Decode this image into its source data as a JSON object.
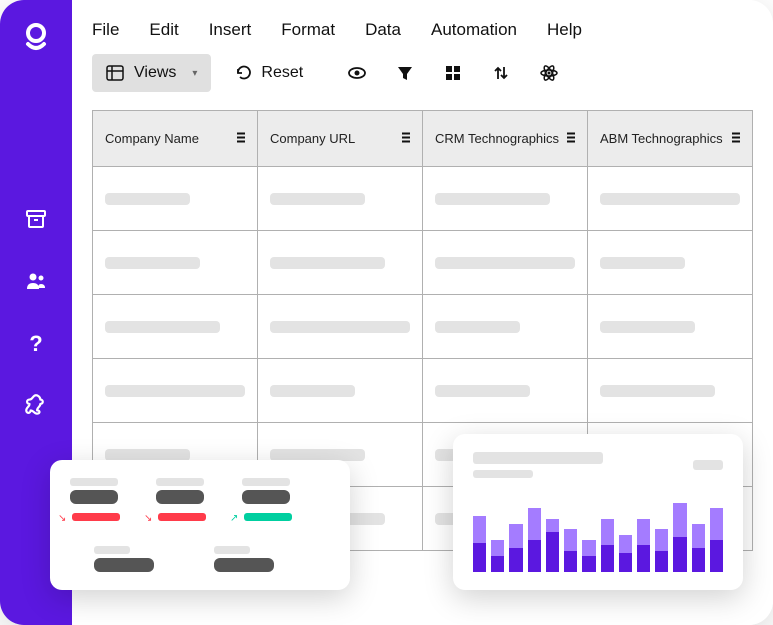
{
  "brand": {
    "accent": "#5b18e0",
    "light_accent": "#a47cff"
  },
  "sidebar": {
    "items": [
      {
        "name": "archive-icon"
      },
      {
        "name": "users-icon"
      },
      {
        "name": "help-icon"
      },
      {
        "name": "integrations-icon"
      }
    ]
  },
  "menubar": {
    "items": [
      "File",
      "Edit",
      "Insert",
      "Format",
      "Data",
      "Automation",
      "Help"
    ]
  },
  "toolbar": {
    "views_label": "Views",
    "reset_label": "Reset",
    "icon_buttons": [
      "visibility-icon",
      "filter-icon",
      "grid-icon",
      "sort-icon",
      "atom-icon"
    ]
  },
  "table": {
    "columns": [
      "Company Name",
      "Company URL",
      "CRM Technographics",
      "ABM Technographics"
    ],
    "row_count": 6
  },
  "overlays": {
    "stats_card": {
      "row1": [
        {
          "trend": "down"
        },
        {
          "trend": "down"
        },
        {
          "trend": "up"
        }
      ],
      "row2_items": 2
    },
    "chart_card": {
      "title_placeholder": true,
      "subtitle_placeholder": true
    }
  },
  "chart_data": {
    "type": "bar",
    "title": "",
    "xlabel": "",
    "ylabel": "",
    "ylim": [
      0,
      60
    ],
    "series": [
      {
        "name": "Light",
        "values": [
          42,
          24,
          36,
          48,
          40,
          32,
          24,
          40,
          28,
          40,
          32,
          52,
          36,
          48
        ]
      },
      {
        "name": "Dark",
        "values": [
          22,
          12,
          18,
          24,
          30,
          16,
          12,
          20,
          14,
          20,
          16,
          26,
          18,
          24
        ]
      }
    ]
  }
}
